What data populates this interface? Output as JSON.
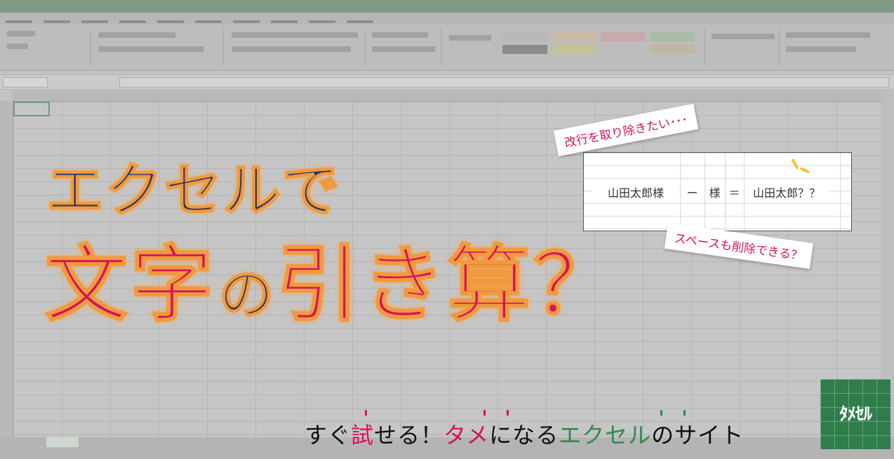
{
  "headline": {
    "line1": "エクセルで",
    "line2_part1": "文字",
    "line2_part2": "の",
    "line2_part3": "引き算？"
  },
  "example": {
    "cells": [
      "山田太郎様",
      "ー",
      "様",
      "＝",
      "山田太郎？？"
    ],
    "callout_top": "改行を取り除きたい･･･",
    "callout_bottom": "スペースも削除できる？"
  },
  "tagline": {
    "part1": "すぐ",
    "part2": "試",
    "part3": "せる！",
    "part4": "タメ",
    "part5": "になる",
    "part6": "エクセル",
    "part7": "のサイト"
  },
  "logo": {
    "text": "ﾀﾒｾﾙ"
  },
  "colors": {
    "accent_pink": "#d4145a",
    "accent_navy": "#24386c",
    "accent_green": "#2f8a4a",
    "glow_orange": "#f09a3e"
  }
}
